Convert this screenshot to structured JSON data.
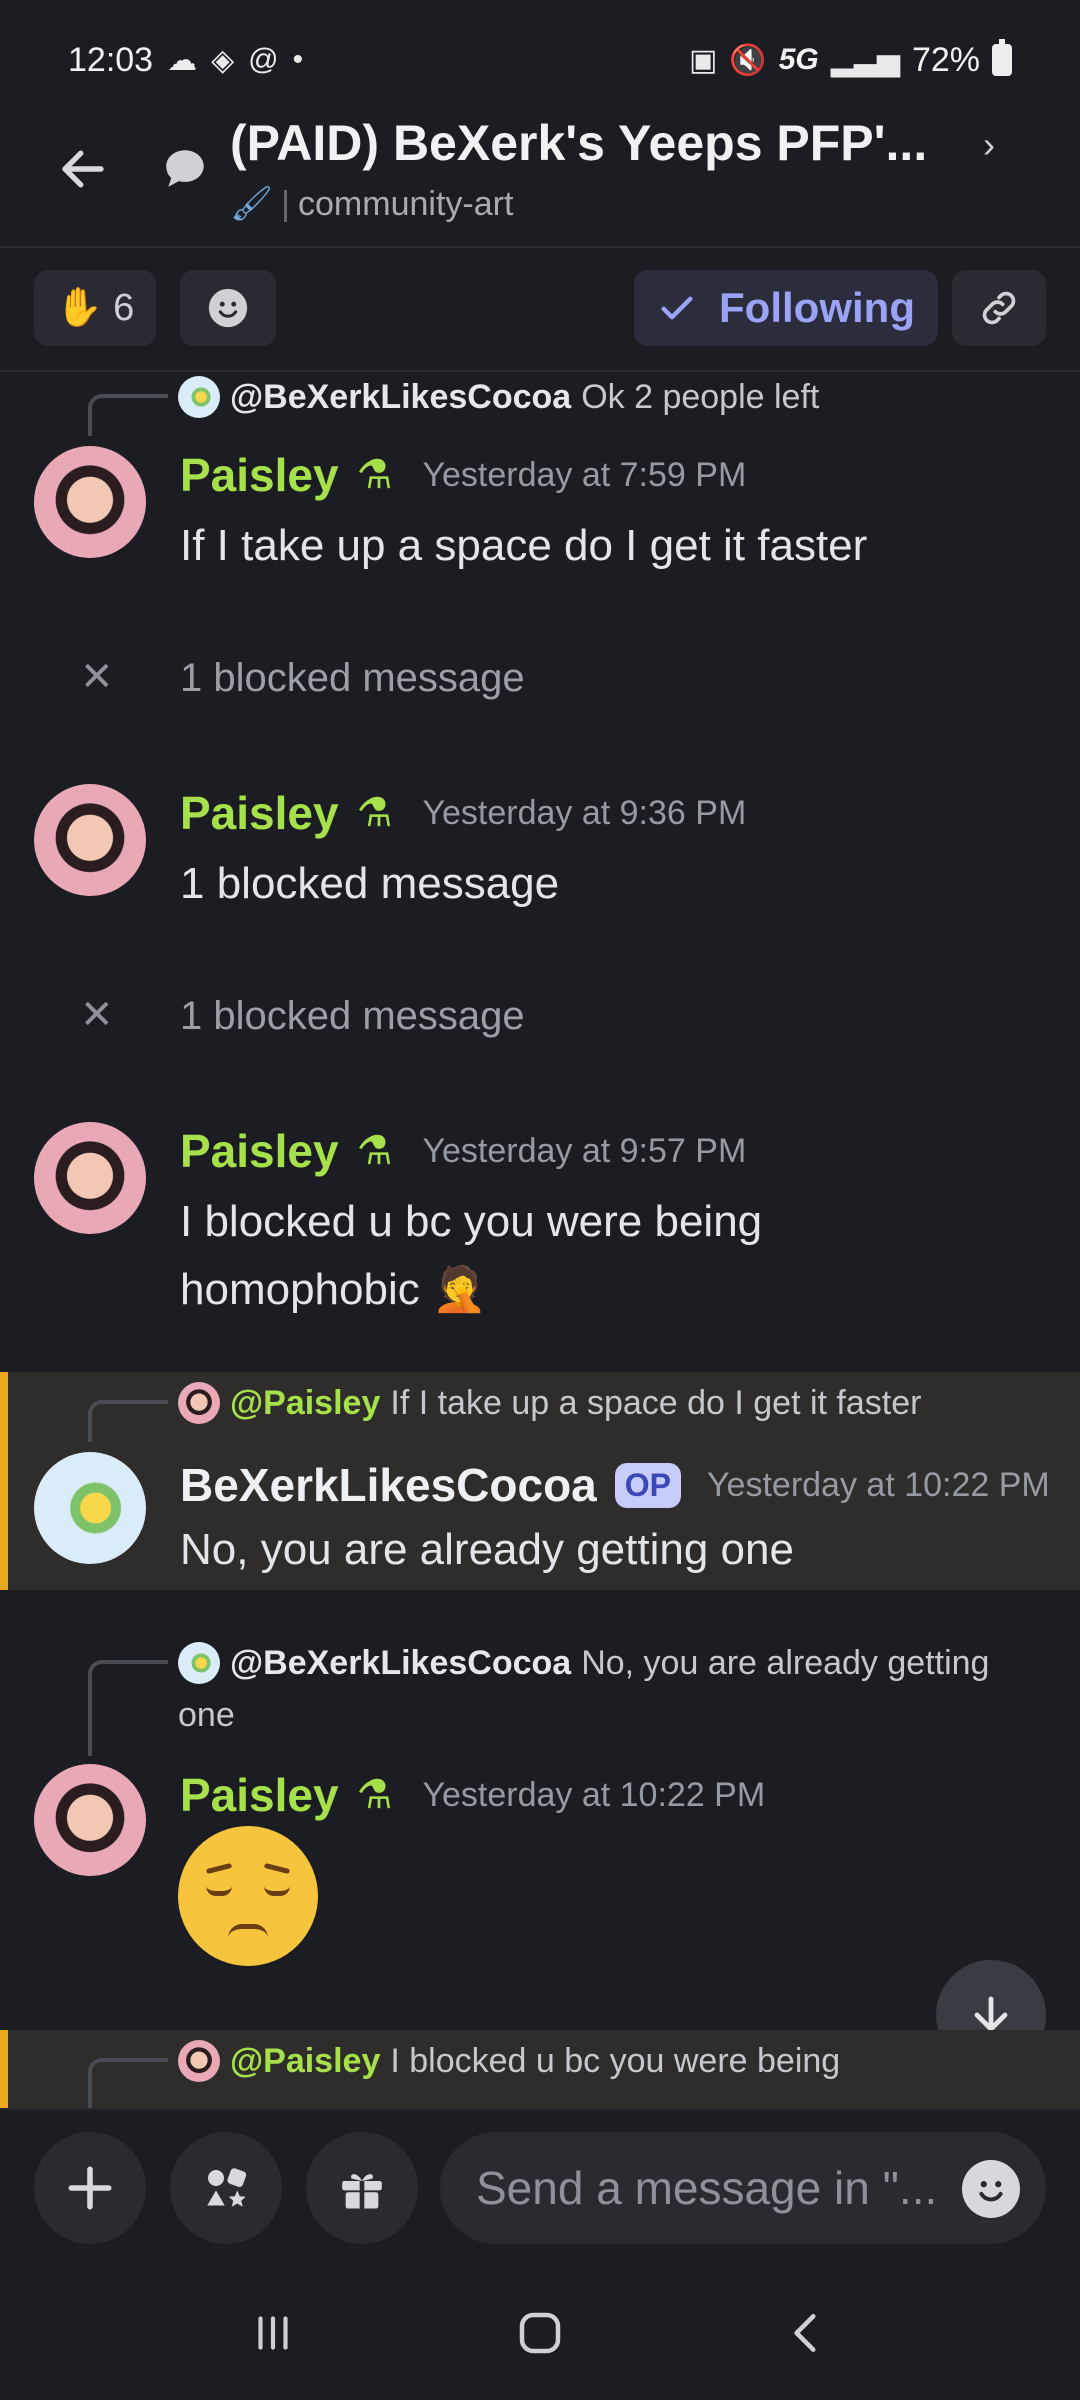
{
  "status": {
    "time": "12:03",
    "network": "5G",
    "battery": "72%"
  },
  "header": {
    "title": "(PAID)  BeXerk's Yeeps PFP'...",
    "channel": "community-art"
  },
  "toolbar": {
    "reaction_count": "6",
    "following_label": "Following"
  },
  "messages": [
    {
      "reply_to": "@BeXerkLikesCocoa",
      "reply_text": "Ok 2 people left",
      "author": "Paisley",
      "time": "Yesterday at 7:59 PM",
      "text": "If I take up a space do I get it faster"
    },
    {
      "blocked": "1 blocked message"
    },
    {
      "author": "Paisley",
      "time": "Yesterday at 9:36 PM",
      "text": "1 blocked message"
    },
    {
      "blocked": "1 blocked message"
    },
    {
      "author": "Paisley",
      "time": "Yesterday at 9:57 PM",
      "text_line1": "I blocked u bc you were being",
      "text_line2": "homophobic 🤦"
    },
    {
      "reply_to": "@Paisley",
      "reply_text": "If I take up a space do I get it faster",
      "author": "BeXerkLikesCocoa",
      "badge": "OP",
      "time": "Yesterday at 10:22 PM",
      "text": "No, you are already getting one"
    },
    {
      "reply_to": "@BeXerkLikesCocoa",
      "reply_text_line1": "No, you are already getting",
      "reply_text_line2": "one",
      "author": "Paisley",
      "time": "Yesterday at 10:22 PM",
      "emoji": "pensive-face"
    },
    {
      "reply_to": "@Paisley",
      "reply_text": "I blocked u bc you were being"
    }
  ],
  "composer": {
    "placeholder": "Send a message in \"..."
  },
  "colors": {
    "accent": "#9aa3f6",
    "username": "#a6e04a",
    "highlight_bar": "#e9a91d"
  }
}
